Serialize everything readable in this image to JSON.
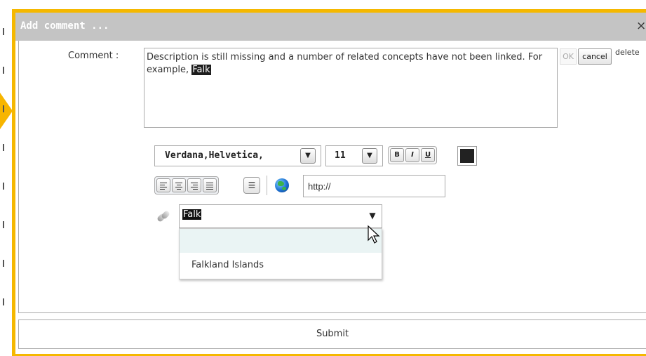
{
  "dialog": {
    "title": "Add comment ...",
    "close_glyph": "×"
  },
  "comment": {
    "label": "Comment :",
    "text": "Description is still missing and a number of related concepts have not been linked. For example,",
    "highlighted": "Falk",
    "ok_label": "OK",
    "cancel_label": "cancel",
    "delete_label": "delete"
  },
  "toolbar": {
    "font_family": "Verdana,Helvetica,",
    "font_size": "11",
    "bold_label": "B",
    "italic_label": "I",
    "underline_label": "U",
    "text_color": "#222222",
    "url_placeholder": "http://"
  },
  "autocomplete": {
    "value": "Falk",
    "options": [
      "",
      "Falkland Islands"
    ]
  },
  "footer": {
    "submit_label": "Submit"
  },
  "colors": {
    "frame_accent": "#f5b800",
    "titlebar": "#c4c4c4"
  }
}
